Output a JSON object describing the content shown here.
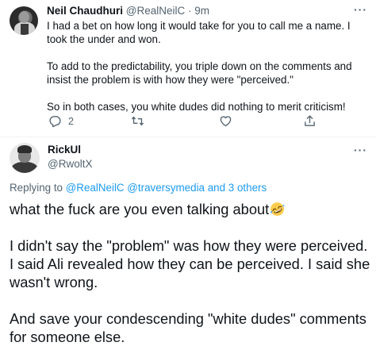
{
  "tweet_1": {
    "author_name": "Neil Chaudhuri",
    "author_handle": "@RealNeilC",
    "separator": "·",
    "time": "9m",
    "paragraphs": [
      "I had a bet on how long it would take for you to call me a name. I took the under and won.",
      "To add to the predictability, you triple down on the comments and insist the problem is with how they were \"perceived.\"",
      "So in both cases, you white dudes did nothing to merit criticism!"
    ],
    "reply_count": "2",
    "icons": [
      "more-icon",
      "reply-icon",
      "retweet-icon",
      "like-icon",
      "share-icon"
    ]
  },
  "tweet_2": {
    "author_name": "RickUl",
    "author_handle": "@RwoltX",
    "replying_prefix": "Replying to ",
    "replying_mentions": "@RealNeilC @traversymedia",
    "replying_others": " and 3 others",
    "first_line": "what the fuck are you even talking about",
    "first_line_emoji": "rolling-on-floor-laughing",
    "paragraphs": [
      "I didn't say the \"problem\" was how they were perceived. I said Ali revealed how they can be perceived. I said she wasn't wrong.",
      "And save your condescending \"white dudes\" comments for someone else."
    ]
  },
  "colors": {
    "text": "#0f1419",
    "secondary": "#536471",
    "link": "#1d9bf0",
    "divider": "#eff3f4",
    "emoji_yellow": "#ffcc4d"
  }
}
